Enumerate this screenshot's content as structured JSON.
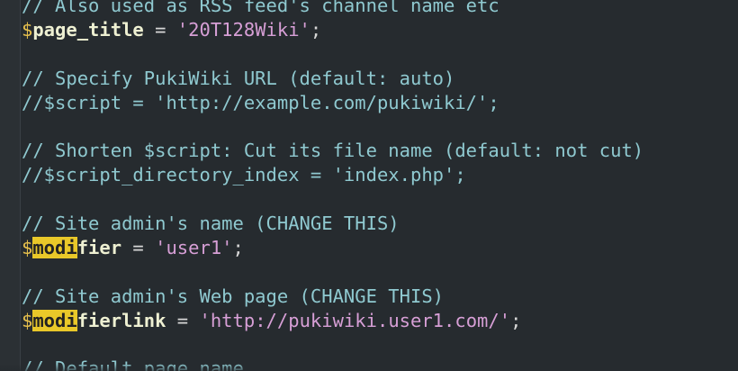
{
  "lines": {
    "l1": {
      "comment": "// Also used as RSS feed's channel name etc"
    },
    "l2": {
      "dollar": "$",
      "var": "page_title",
      "op": " = ",
      "str": "'20T128Wiki'",
      "semi": ";"
    },
    "l3": {
      "comment": ""
    },
    "l4": {
      "comment": "// Specify PukiWiki URL (default: auto)"
    },
    "l5": {
      "comment": "//$script = 'http://example.com/pukiwiki/';"
    },
    "l6": {
      "comment": ""
    },
    "l7": {
      "comment": "// Shorten $script: Cut its file name (default: not cut)"
    },
    "l8": {
      "comment": "//$script_directory_index = 'index.php';"
    },
    "l9": {
      "comment": ""
    },
    "l10": {
      "comment": "// Site admin's name (CHANGE THIS)"
    },
    "l11": {
      "dollar": "$",
      "hl": "modi",
      "var": "fier",
      "op": " = ",
      "str": "'user1'",
      "semi": ";"
    },
    "l12": {
      "comment": ""
    },
    "l13": {
      "comment": "// Site admin's Web page (CHANGE THIS)"
    },
    "l14": {
      "dollar": "$",
      "hl": "modi",
      "var": "fierlink",
      "op": " = ",
      "str": "'http://pukiwiki.user1.com/'",
      "semi": ";"
    },
    "l15": {
      "comment": ""
    },
    "l16": {
      "comment": "// Default page name"
    }
  },
  "search_highlight": "modi",
  "colors": {
    "background": "#262b2f",
    "comment": "#8fc9d0",
    "variable_sigil": "#e8c14d",
    "string": "#d79fd6",
    "highlight": "#e9c829"
  }
}
